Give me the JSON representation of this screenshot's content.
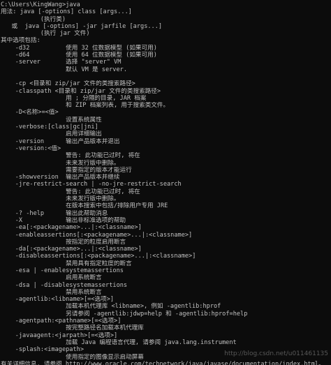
{
  "window": {
    "background": "#0c0c0c",
    "text_color": "#c0c0c0"
  },
  "console_lines": [
    "C:\\Users\\KingWang>java",
    "用法: java [-options] class [args...]",
    "           (执行类)",
    "   或  java [-options] -jar jarfile [args...]",
    "           (执行 jar 文件)",
    "其中选项包括:",
    "    -d32          使用 32 位数据模型 (如果可用)",
    "    -d64          使用 64 位数据模型 (如果可用)",
    "    -server       选择 \"server\" VM",
    "                  默认 VM 是 server.",
    "",
    "    -cp <目录和 zip/jar 文件的类搜索路径>",
    "    -classpath <目录和 zip/jar 文件的类搜索路径>",
    "                  用 ; 分隔的目录, JAR 档案",
    "                  和 ZIP 档案列表, 用于搜索类文件。",
    "    -D<名称>=<值>",
    "                  设置系统属性",
    "    -verbose:[class|gc|jni]",
    "                  启用详细输出",
    "    -version      输出产品版本并退出",
    "    -version:<值>",
    "                  警告: 此功能已过时, 将在",
    "                  未来发行版中删除。",
    "                  需要指定的版本才能运行",
    "    -showversion  输出产品版本并继续",
    "    -jre-restrict-search | -no-jre-restrict-search",
    "                  警告: 此功能已过时, 将在",
    "                  未来发行版中删除。",
    "                  在版本搜索中包括/排除用户专用 JRE",
    "    -? -help      输出此帮助消息",
    "    -X            输出非标准选项的帮助",
    "    -ea[:<packagename>...|:<classname>]",
    "    -enableassertions[:<packagename>...|:<classname>]",
    "                  按指定的粒度启用断言",
    "    -da[:<packagename>...|:<classname>]",
    "    -disableassertions[:<packagename>...|:<classname>]",
    "                  禁用具有指定粒度的断言",
    "    -esa | -enablesystemassertions",
    "                  启用系统断言",
    "    -dsa | -disablesystemassertions",
    "                  禁用系统断言",
    "    -agentlib:<libname>[=<选项>]",
    "                  加载本机代理库 <libname>, 例如 -agentlib:hprof",
    "                  另请参阅 -agentlib:jdwp=help 和 -agentlib:hprof=help",
    "    -agentpath:<pathname>[=<选项>]",
    "                  按完整路径名加载本机代理库",
    "    -javaagent:<jarpath>[=<选项>]",
    "                  加载 Java 编程语言代理, 请参阅 java.lang.instrument",
    "    -splash:<imagepath>",
    "                  使用指定的图像显示启动屏幕",
    "有关详细信息, 请参阅 http://www.oracle.com/technetwork/java/javase/documentation/index.html。"
  ],
  "watermark": "http://blog.csdn.net/u011461135"
}
